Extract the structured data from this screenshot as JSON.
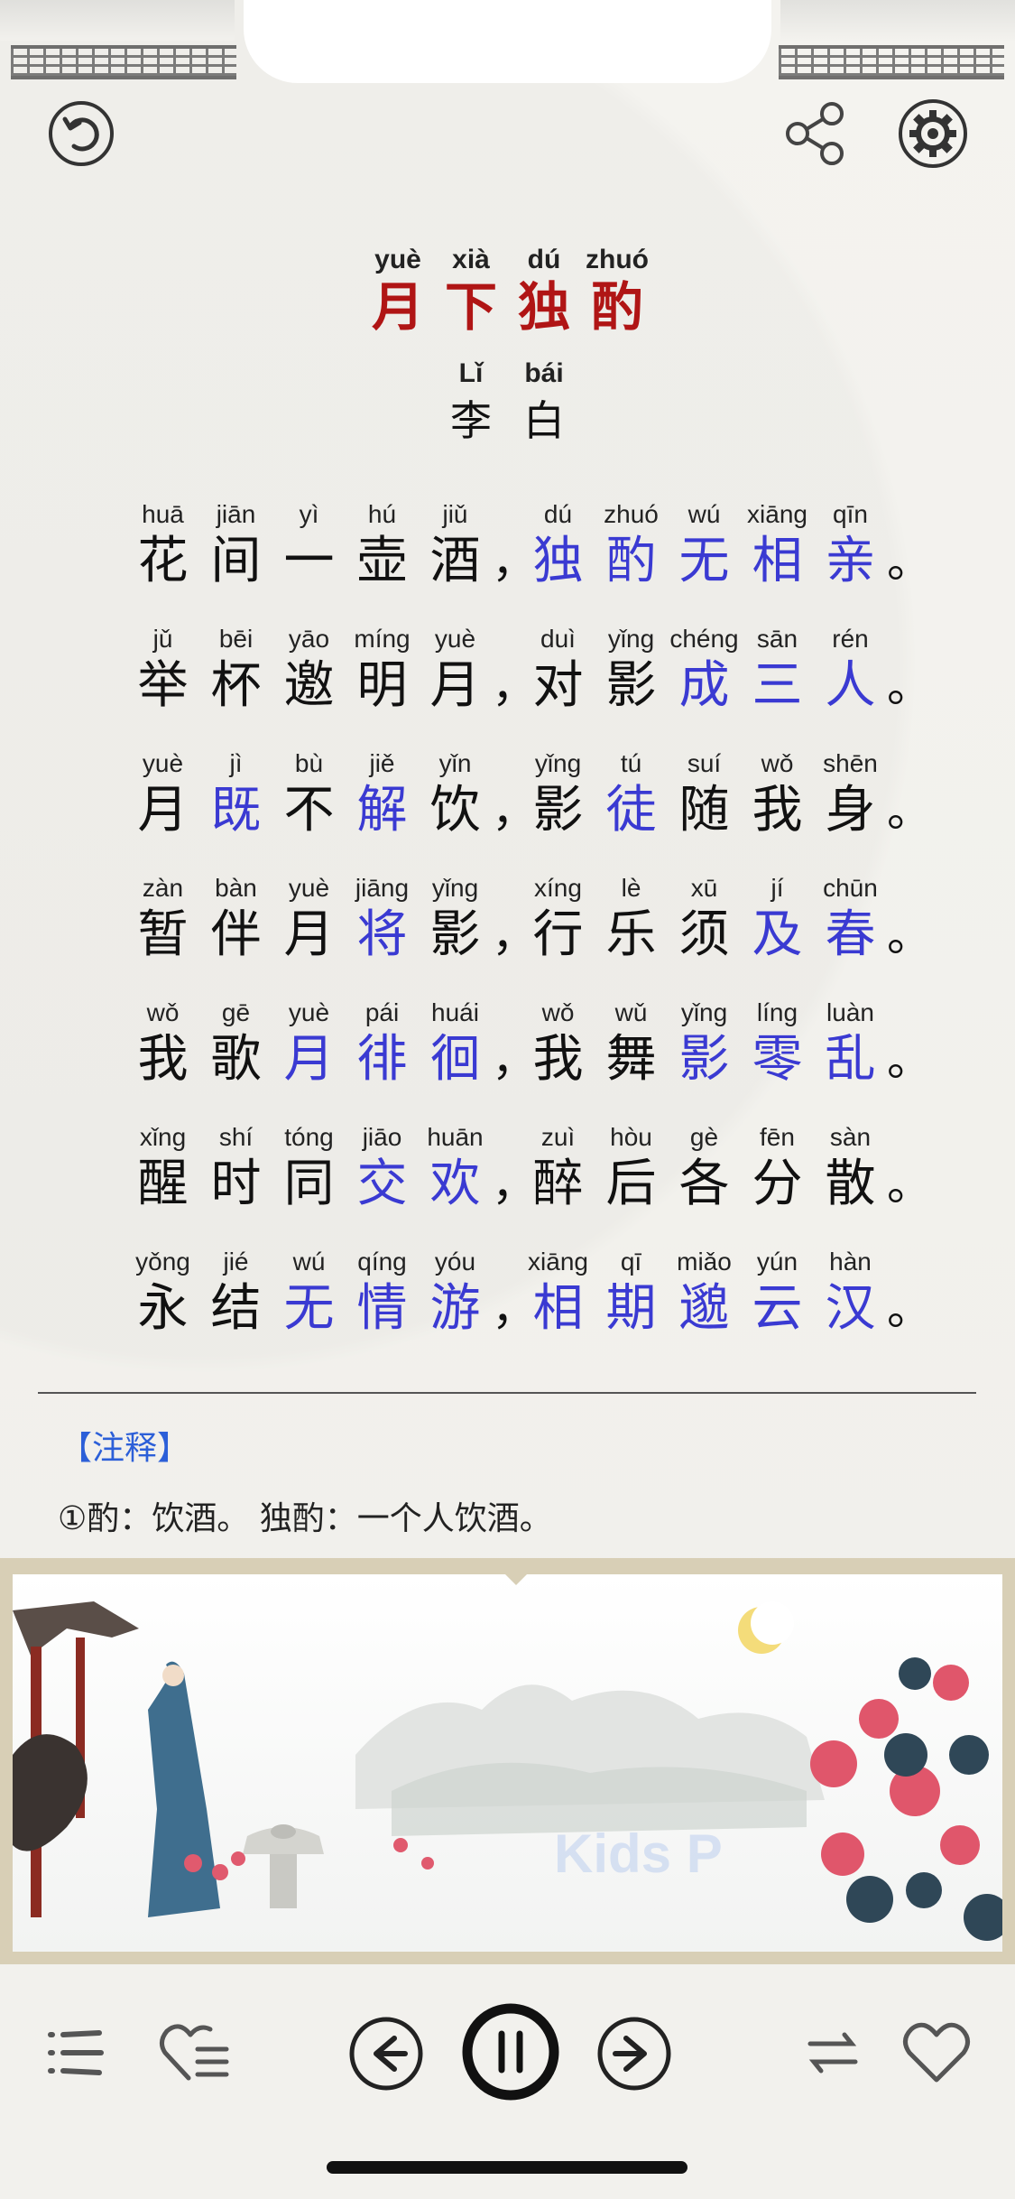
{
  "title": {
    "pinyin": [
      "yuè",
      "xià",
      "dú",
      "zhuó"
    ],
    "hanzi": [
      "月",
      "下",
      "独",
      "酌"
    ]
  },
  "author": {
    "pinyin": [
      "Lǐ",
      "bái"
    ],
    "hanzi": [
      "李",
      "白"
    ]
  },
  "poem": [
    {
      "left": [
        [
          "huā",
          "花",
          0
        ],
        [
          "jiān",
          "间",
          0
        ],
        [
          "yì",
          "一",
          0
        ],
        [
          "hú",
          "壶",
          0
        ],
        [
          "jiǔ",
          "酒",
          0
        ]
      ],
      "sep": "，",
      "right": [
        [
          "dú",
          "独",
          1
        ],
        [
          "zhuó",
          "酌",
          1
        ],
        [
          "wú",
          "无",
          1
        ],
        [
          "xiāng",
          "相",
          1
        ],
        [
          "qīn",
          "亲",
          1
        ]
      ],
      "end": "。"
    },
    {
      "left": [
        [
          "jǔ",
          "举",
          0
        ],
        [
          "bēi",
          "杯",
          0
        ],
        [
          "yāo",
          "邀",
          0
        ],
        [
          "míng",
          "明",
          0
        ],
        [
          "yuè",
          "月",
          0
        ]
      ],
      "sep": "，",
      "right": [
        [
          "duì",
          "对",
          0
        ],
        [
          "yǐng",
          "影",
          0
        ],
        [
          "chéng",
          "成",
          1
        ],
        [
          "sān",
          "三",
          1
        ],
        [
          "rén",
          "人",
          1
        ]
      ],
      "end": "。"
    },
    {
      "left": [
        [
          "yuè",
          "月",
          0
        ],
        [
          "jì",
          "既",
          1
        ],
        [
          "bù",
          "不",
          0
        ],
        [
          "jiě",
          "解",
          1
        ],
        [
          "yǐn",
          "饮",
          0
        ]
      ],
      "sep": "，",
      "right": [
        [
          "yǐng",
          "影",
          0
        ],
        [
          "tú",
          "徒",
          1
        ],
        [
          "suí",
          "随",
          0
        ],
        [
          "wǒ",
          "我",
          0
        ],
        [
          "shēn",
          "身",
          0
        ]
      ],
      "end": "。"
    },
    {
      "left": [
        [
          "zàn",
          "暂",
          0
        ],
        [
          "bàn",
          "伴",
          0
        ],
        [
          "yuè",
          "月",
          0
        ],
        [
          "jiāng",
          "将",
          1
        ],
        [
          "yǐng",
          "影",
          0
        ]
      ],
      "sep": "，",
      "right": [
        [
          "xíng",
          "行",
          0
        ],
        [
          "lè",
          "乐",
          0
        ],
        [
          "xū",
          "须",
          0
        ],
        [
          "jí",
          "及",
          1
        ],
        [
          "chūn",
          "春",
          1
        ]
      ],
      "end": "。"
    },
    {
      "left": [
        [
          "wǒ",
          "我",
          0
        ],
        [
          "gē",
          "歌",
          0
        ],
        [
          "yuè",
          "月",
          1
        ],
        [
          "pái",
          "徘",
          1
        ],
        [
          "huái",
          "徊",
          1
        ]
      ],
      "sep": "，",
      "right": [
        [
          "wǒ",
          "我",
          0
        ],
        [
          "wǔ",
          "舞",
          0
        ],
        [
          "yǐng",
          "影",
          1
        ],
        [
          "líng",
          "零",
          1
        ],
        [
          "luàn",
          "乱",
          1
        ]
      ],
      "end": "。"
    },
    {
      "left": [
        [
          "xǐng",
          "醒",
          0
        ],
        [
          "shí",
          "时",
          0
        ],
        [
          "tóng",
          "同",
          0
        ],
        [
          "jiāo",
          "交",
          1
        ],
        [
          "huān",
          "欢",
          1
        ]
      ],
      "sep": "，",
      "right": [
        [
          "zuì",
          "醉",
          0
        ],
        [
          "hòu",
          "后",
          0
        ],
        [
          "gè",
          "各",
          0
        ],
        [
          "fēn",
          "分",
          0
        ],
        [
          "sàn",
          "散",
          0
        ]
      ],
      "end": "。"
    },
    {
      "left": [
        [
          "yǒng",
          "永",
          0
        ],
        [
          "jié",
          "结",
          0
        ],
        [
          "wú",
          "无",
          1
        ],
        [
          "qíng",
          "情",
          1
        ],
        [
          "yóu",
          "游",
          1
        ]
      ],
      "sep": "，",
      "right": [
        [
          "xiāng",
          "相",
          1
        ],
        [
          "qī",
          "期",
          1
        ],
        [
          "miǎo",
          "邈",
          1
        ],
        [
          "yún",
          "云",
          1
        ],
        [
          "hàn",
          "汉",
          1
        ]
      ],
      "end": "。"
    }
  ],
  "notes": {
    "heading": "【注释】",
    "text": "①酌：饮酒。 独酌：一个人饮酒。"
  },
  "painting": {
    "watermark": "Kids P"
  },
  "colors": {
    "title": "#b01515",
    "highlight": "#3a3ad2",
    "notes": "#2c5fd8"
  }
}
